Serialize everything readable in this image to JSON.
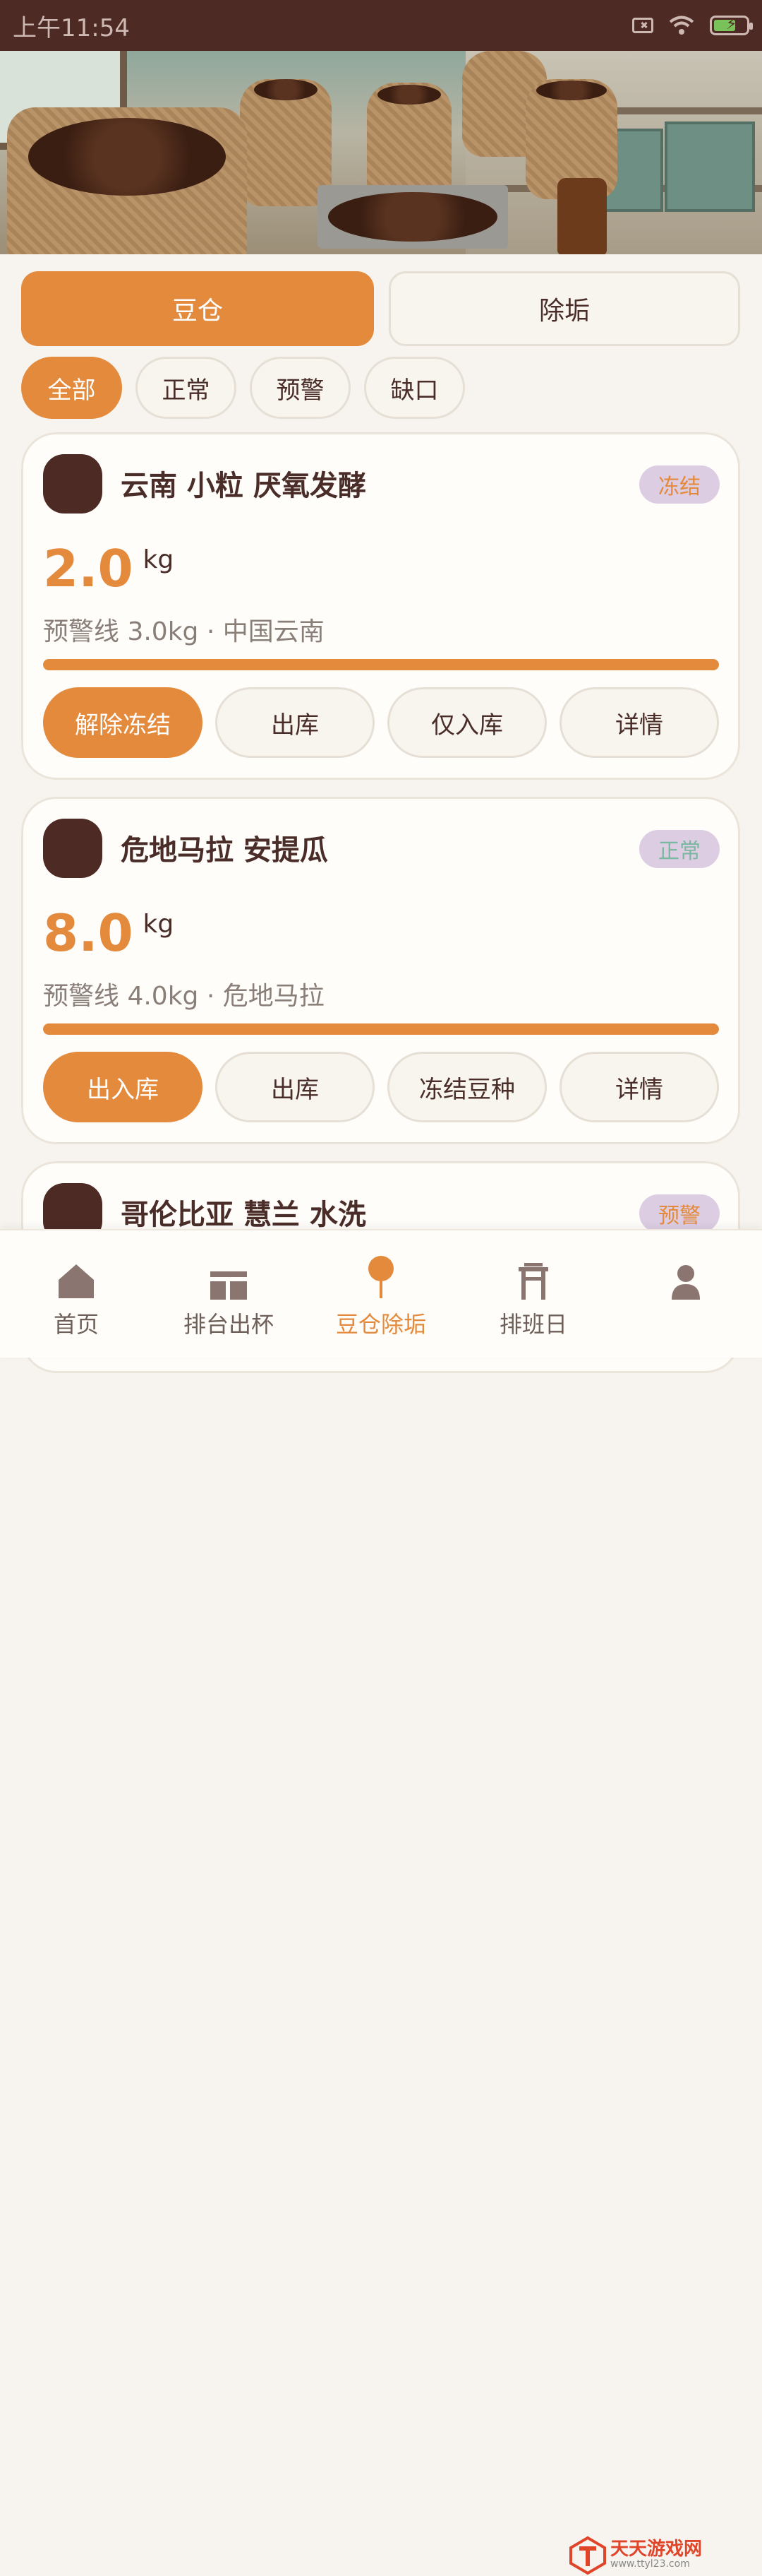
{
  "status_bar": {
    "time": "上午11:54",
    "icons": [
      "sim-blocked-icon",
      "wifi-icon",
      "battery-charging-icon"
    ]
  },
  "segments": [
    {
      "label": "豆仓",
      "active": true
    },
    {
      "label": "除垢",
      "active": false
    }
  ],
  "filters": [
    {
      "label": "全部",
      "active": true
    },
    {
      "label": "正常",
      "active": false
    },
    {
      "label": "预警",
      "active": false
    },
    {
      "label": "缺口",
      "active": false
    }
  ],
  "cards": [
    {
      "name": "云南 小粒 厌氧发酵",
      "badge": "冻结",
      "badge_color": "#e48a3c",
      "qty": "2.0",
      "unit": "kg",
      "meta": "预警线 3.0kg · 中国云南",
      "level": 1.0,
      "actions": [
        "解除冻结",
        "出库",
        "仅入库",
        "详情"
      ]
    },
    {
      "name": "危地马拉 安提瓜",
      "badge": "正常",
      "badge_color": "#7cb8a0",
      "qty": "8.0",
      "unit": "kg",
      "meta": "预警线 4.0kg · 危地马拉",
      "level": 1.0,
      "actions": [
        "出入库",
        "出库",
        "冻结豆种",
        "详情"
      ]
    },
    {
      "name": "哥伦比亚 慧兰 水洗",
      "badge": "预警",
      "badge_color": "#e48a3c"
    }
  ],
  "nav": [
    {
      "label": "首页",
      "icon": "home-icon",
      "active": false
    },
    {
      "label": "排台出杯",
      "icon": "counter-icon",
      "active": false
    },
    {
      "label": "豆仓除垢",
      "icon": "pin-icon",
      "active": true
    },
    {
      "label": "排班日",
      "icon": "schedule-icon",
      "active": false
    },
    {
      "label": "",
      "icon": "profile-icon",
      "active": false
    }
  ],
  "watermark": {
    "title": "天天游戏网",
    "url": "www.ttyl23.com"
  },
  "colors": {
    "accent": "#e48a3c",
    "dark": "#4e2a25",
    "badge_bg": "#dccde3"
  }
}
